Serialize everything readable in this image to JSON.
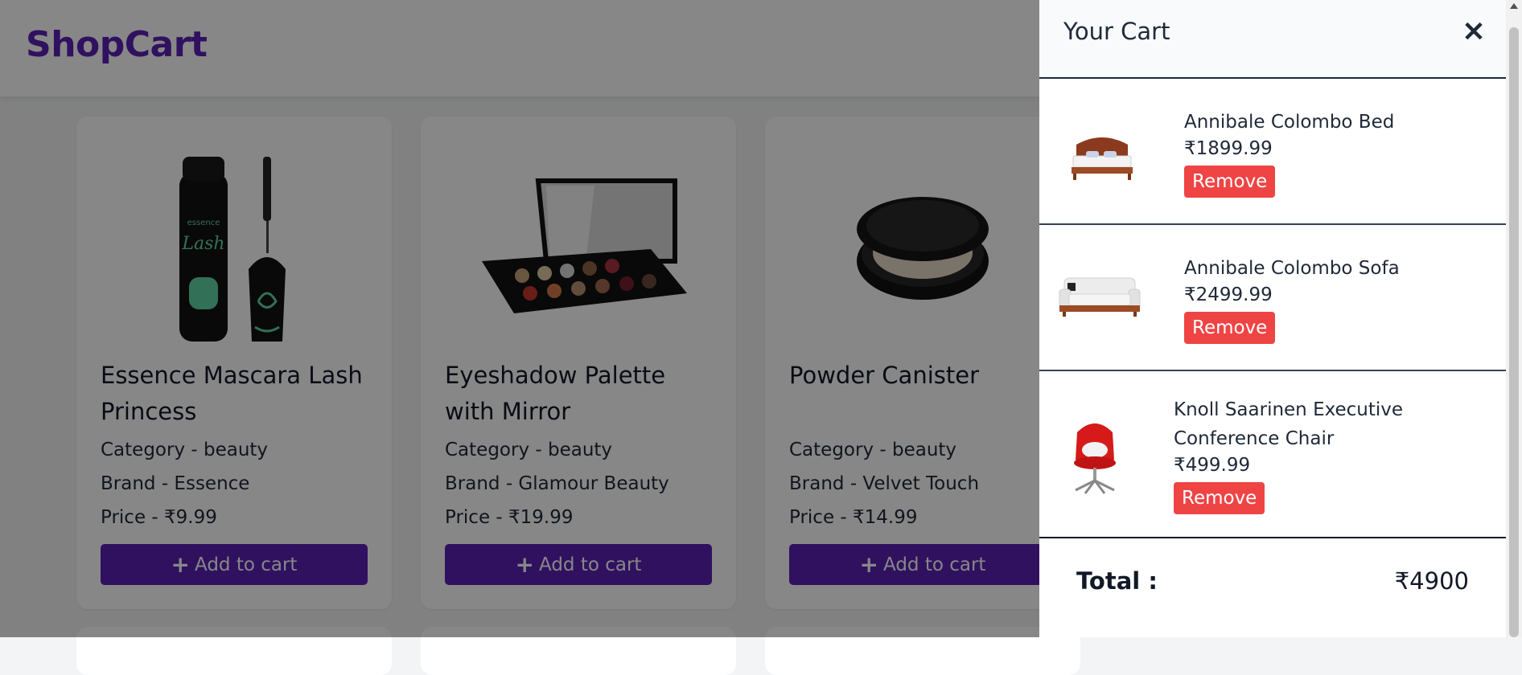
{
  "header": {
    "logo": "ShopCart"
  },
  "products": [
    {
      "title": "Essence Mascara Lash Princess",
      "category": "Category - beauty",
      "brand": "Brand - Essence",
      "price": "Price - ₹9.99",
      "image_icon": "mascara-image",
      "add_label": "Add to cart"
    },
    {
      "title": "Eyeshadow Palette with Mirror",
      "category": "Category - beauty",
      "brand": "Brand - Glamour Beauty",
      "price": "Price - ₹19.99",
      "image_icon": "eyeshadow-palette-image",
      "add_label": "Add to cart"
    },
    {
      "title": "Powder Canister",
      "category": "Category - beauty",
      "brand": "Brand - Velvet Touch",
      "price": "Price - ₹14.99",
      "image_icon": "powder-canister-image",
      "add_label": "Add to cart"
    }
  ],
  "cart": {
    "title": "Your Cart",
    "close_icon": "close-icon",
    "items": [
      {
        "name": "Annibale Colombo Bed",
        "price": "₹1899.99",
        "remove_label": "Remove",
        "image_icon": "bed-image"
      },
      {
        "name": "Annibale Colombo Sofa",
        "price": "₹2499.99",
        "remove_label": "Remove",
        "image_icon": "sofa-image"
      },
      {
        "name": "Knoll Saarinen Executive Conference Chair",
        "price": "₹499.99",
        "remove_label": "Remove",
        "image_icon": "chair-image"
      }
    ],
    "total_label": "Total :",
    "total_value": "₹4900"
  },
  "colors": {
    "brand": "#5b21b6",
    "remove": "#ef4444",
    "overlay": "rgba(0,0,0,0.47)"
  }
}
